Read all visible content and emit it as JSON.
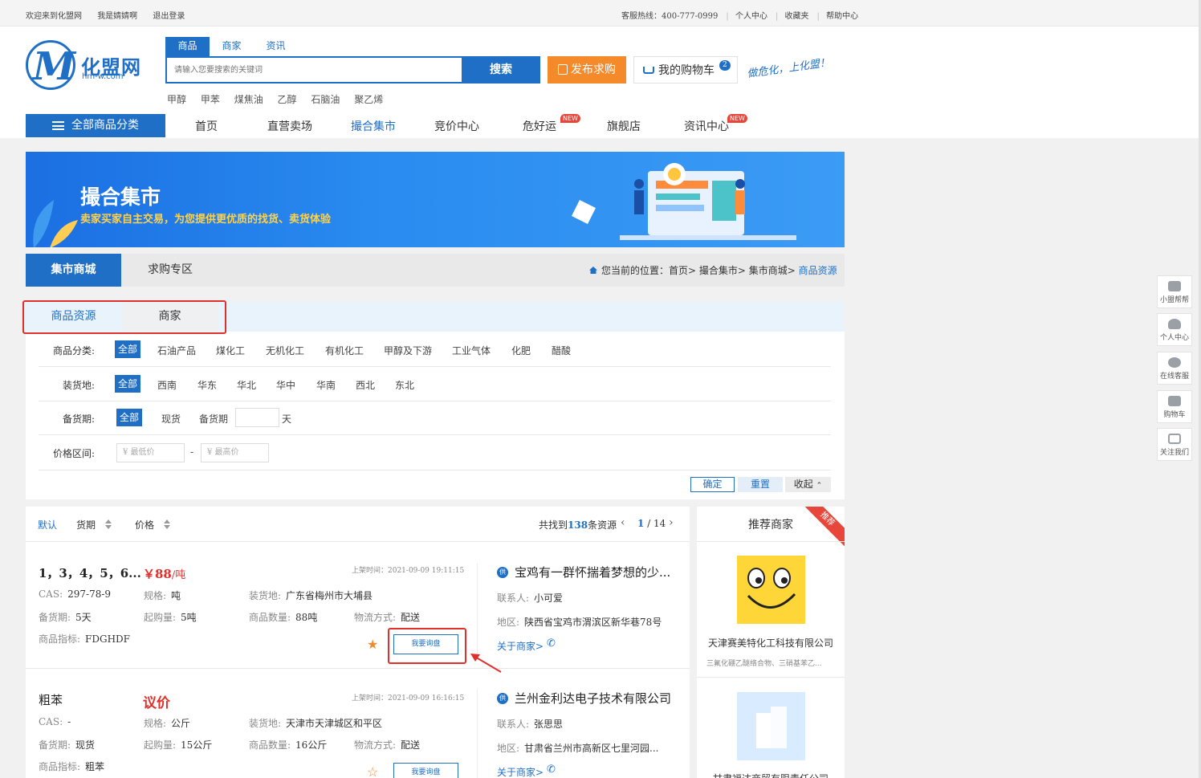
{
  "topbar": {
    "welcome": "欢迎来到化盟网",
    "user": "我是婧婧啊",
    "logout": "退出登录",
    "hotline": "客服热线：400-777-0999",
    "links": [
      "个人中心",
      "收藏夹",
      "帮助中心"
    ]
  },
  "logo": {
    "cn": "化盟网",
    "en": "hm-w.com"
  },
  "search": {
    "tabs": [
      "商品",
      "商家",
      "资讯"
    ],
    "placeholder": "请输入您要搜索的关键词",
    "button": "搜索",
    "hot": [
      "甲醇",
      "甲苯",
      "煤焦油",
      "乙醇",
      "石脑油",
      "聚乙烯"
    ]
  },
  "publish_button": "发布求购",
  "cart": {
    "label": "我的购物车",
    "count": "2"
  },
  "slogan": "做危化，上化盟！",
  "nav": {
    "all_categories": "全部商品分类",
    "items": [
      "首页",
      "直营卖场",
      "撮合集市",
      "竞价中心",
      "危好运",
      "旗舰店",
      "资讯中心"
    ],
    "active": "撮合集市",
    "new_badge": "NEW"
  },
  "banner": {
    "title": "撮合集市",
    "subtitle": "卖家买家自主交易，为您提供更优质的找货、卖货体验"
  },
  "page_tabs": [
    "集市商城",
    "求购专区"
  ],
  "breadcrumb": {
    "prefix": "您当前的位置：",
    "path": "首页> 撮合集市> 集市商城> ",
    "current": "商品资源"
  },
  "sub_tabs": [
    "商品资源",
    "商家"
  ],
  "filters": {
    "category": {
      "label": "商品分类:",
      "options": [
        "全部",
        "石油产品",
        "煤化工",
        "无机化工",
        "有机化工",
        "甲醇及下游",
        "工业气体",
        "化肥",
        "醋酸"
      ]
    },
    "location": {
      "label": "装货地:",
      "options": [
        "全部",
        "西南",
        "华东",
        "华北",
        "华中",
        "华南",
        "西北",
        "东北"
      ]
    },
    "stock": {
      "label": "备货期:",
      "options": [
        "全部",
        "现货",
        "备货期"
      ],
      "unit": "天"
    },
    "price": {
      "label": "价格区间:",
      "min_placeholder": "¥ 最低价",
      "max_placeholder": "¥ 最高价",
      "dash": "-"
    },
    "confirm": "确定",
    "reset": "重置",
    "collapse": "收起"
  },
  "list_header": {
    "sorts": [
      "默认",
      "货期",
      "价格"
    ],
    "found_prefix": "共找到",
    "found_count": "138",
    "found_suffix": "条资源",
    "page_current": "1",
    "page_total": "/ 14"
  },
  "products": [
    {
      "name": "1，3，4，5，6...",
      "price": "￥88",
      "price_unit": "/吨",
      "time": "上架时间：2021-09-09 19:11:15",
      "cas_label": "CAS:",
      "cas": "297-78-9",
      "spec_label": "规格:",
      "spec": "吨",
      "loc_label": "装货地:",
      "loc": "广东省梅州市大埔县",
      "stock_label": "备货期:",
      "stock": "5天",
      "moq_label": "起购量:",
      "moq": "5吨",
      "qty_label": "商品数量:",
      "qty": "88吨",
      "ship_label": "物流方式:",
      "ship": "配送",
      "index_label": "商品指标:",
      "index": "FDGHDF",
      "inquiry": "我要询盘",
      "seller": {
        "name": "宝鸡有一群怀揣着梦想的少...",
        "contact_label": "联系人:",
        "contact": "小可爱",
        "area_label": "地区:",
        "area": "陕西省宝鸡市渭滨区新华巷78号",
        "about": "关于商家>"
      }
    },
    {
      "name": "粗苯",
      "price": "议价",
      "price_unit": "",
      "time": "上架时间：2021-09-09 16:16:15",
      "cas_label": "CAS:",
      "cas": "-",
      "spec_label": "规格:",
      "spec": "公斤",
      "loc_label": "装货地:",
      "loc": "天津市天津城区和平区",
      "stock_label": "备货期:",
      "stock": "现货",
      "moq_label": "起购量:",
      "moq": "15公斤",
      "qty_label": "商品数量:",
      "qty": "16公斤",
      "ship_label": "物流方式:",
      "ship": "配送",
      "index_label": "商品指标:",
      "index": "粗苯",
      "inquiry": "我要询盘",
      "seller": {
        "name": "兰州金利达电子技术有限公司",
        "contact_label": "联系人:",
        "contact": "张思思",
        "area_label": "地区:",
        "area": "甘肃省兰州市高新区七里河园...",
        "about": "关于商家>"
      }
    }
  ],
  "recommend": {
    "title": "推荐商家",
    "tag": "推荐",
    "merchants": [
      {
        "name": "天津赛美特化工科技有限公司",
        "desc": "三氟化硼乙醚络合物、三硝基苯乙..."
      },
      {
        "name": "甘肃福达商贸有限责任公司",
        "desc": ""
      }
    ]
  },
  "sidebar": [
    "小盟帮帮",
    "个人中心",
    "在线客服",
    "购物车",
    "关注我们"
  ],
  "colors": {
    "primary": "#1f6fc6",
    "orange": "#f58a2a",
    "red": "#e0302c"
  }
}
